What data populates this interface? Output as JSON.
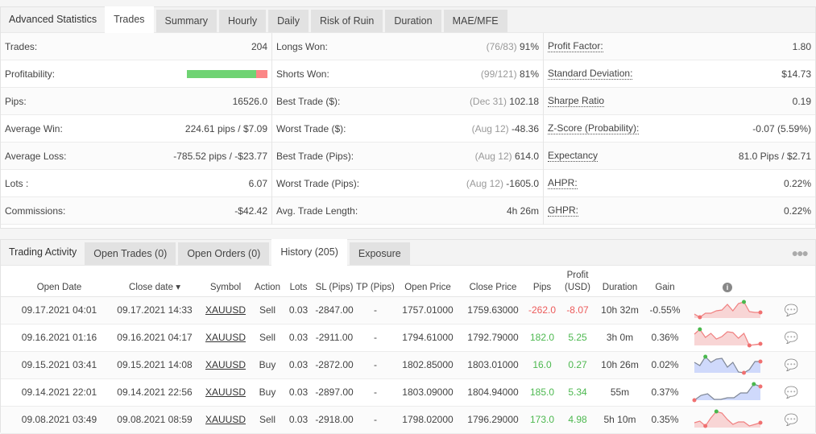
{
  "advanced_stats": {
    "title": "Advanced Statistics",
    "tabs": [
      "Trades",
      "Summary",
      "Hourly",
      "Daily",
      "Risk of Ruin",
      "Duration",
      "MAE/MFE"
    ],
    "active_tab": "Trades",
    "col1": [
      {
        "label": "Trades:",
        "value": "204"
      },
      {
        "label": "Profitability:",
        "value": "",
        "bar_win_fraction": 0.858
      },
      {
        "label": "Pips:",
        "value": "16526.0"
      },
      {
        "label": "Average Win:",
        "value": "224.61 pips / $7.09"
      },
      {
        "label": "Average Loss:",
        "value": "-785.52 pips / -$23.77"
      },
      {
        "label": "Lots :",
        "value": "6.07"
      },
      {
        "label": "Commissions:",
        "value": "-$42.42"
      }
    ],
    "col2": [
      {
        "label": "Longs Won:",
        "muted": "(76/83)",
        "value": "91%"
      },
      {
        "label": "Shorts Won:",
        "muted": "(99/121)",
        "value": "81%"
      },
      {
        "label": "Best Trade ($):",
        "muted": "(Dec 31)",
        "value": "102.18"
      },
      {
        "label": "Worst Trade ($):",
        "muted": "(Aug 12)",
        "value": "-48.36"
      },
      {
        "label": "Best Trade (Pips):",
        "muted": "(Aug 12)",
        "value": "614.0"
      },
      {
        "label": "Worst Trade (Pips):",
        "muted": "(Aug 12)",
        "value": "-1605.0"
      },
      {
        "label": "Avg. Trade Length:",
        "muted": "",
        "value": "4h 26m"
      }
    ],
    "col3": [
      {
        "label": "Profit Factor:",
        "value": "1.80"
      },
      {
        "label": "Standard Deviation:",
        "value": "$14.73"
      },
      {
        "label": "Sharpe Ratio",
        "value": "0.19"
      },
      {
        "label": "Z-Score (Probability):",
        "value": "-0.07 (5.59%)"
      },
      {
        "label": "Expectancy",
        "value": "81.0 Pips / $2.71"
      },
      {
        "label": "AHPR:",
        "value": "0.22%"
      },
      {
        "label": "GHPR:",
        "value": "0.22%"
      }
    ]
  },
  "trading_activity": {
    "title": "Trading Activity",
    "tabs": [
      "Open Trades (0)",
      "Open Orders (0)",
      "History (205)",
      "Exposure"
    ],
    "active_tab": "History (205)",
    "more_icon": "ellipsis-icon",
    "columns": {
      "open_date": "Open Date",
      "close_date": "Close date ▾",
      "symbol": "Symbol",
      "action": "Action",
      "lots": "Lots",
      "sl": "SL (Pips)",
      "tp": "TP (Pips)",
      "open_price": "Open Price",
      "close_price": "Close Price",
      "pips": "Pips",
      "profit": "Profit (USD)",
      "duration": "Duration",
      "gain": "Gain",
      "info": "i"
    },
    "rows": [
      {
        "open_date": "09.17.2021 04:01",
        "close_date": "09.17.2021 14:33",
        "symbol": "XAUUSD",
        "action": "Sell",
        "lots": "0.03",
        "sl": "-2847.00",
        "tp": "-",
        "open_price": "1757.01000",
        "close_price": "1759.63000",
        "pips": "-262.0",
        "profit": "-8.07",
        "duration": "10h 32m",
        "gain": "-0.55%",
        "positive": false,
        "spark": {
          "color": "red",
          "points": [
            0.25,
            0.05,
            0.3,
            0.3,
            0.45,
            0.5,
            0.85,
            0.45,
            0.9,
            1.0,
            0.4,
            0.35,
            0.35
          ],
          "max_index": 9,
          "end_index": 12
        }
      },
      {
        "open_date": "09.16.2021 01:16",
        "close_date": "09.16.2021 04:17",
        "symbol": "XAUUSD",
        "action": "Sell",
        "lots": "0.03",
        "sl": "-2911.00",
        "tp": "-",
        "open_price": "1794.61000",
        "close_price": "1792.79000",
        "pips": "182.0",
        "profit": "5.25",
        "duration": "3h 0m",
        "gain": "0.36%",
        "positive": true,
        "spark": {
          "color": "red",
          "points": [
            0.7,
            1.0,
            0.5,
            0.75,
            0.4,
            0.55,
            0.85,
            0.8,
            0.45,
            0.75,
            0.0,
            0.05,
            0.1
          ],
          "max_index": 1,
          "end_index": 12
        }
      },
      {
        "open_date": "09.15.2021 03:41",
        "close_date": "09.15.2021 14:08",
        "symbol": "XAUUSD",
        "action": "Buy",
        "lots": "0.03",
        "sl": "-2872.00",
        "tp": "-",
        "open_price": "1802.85000",
        "close_price": "1803.01000",
        "pips": "16.0",
        "profit": "0.27",
        "duration": "10h 26m",
        "gain": "0.02%",
        "positive": true,
        "spark": {
          "color": "blue",
          "points": [
            0.65,
            0.45,
            1.0,
            0.65,
            0.85,
            0.9,
            0.35,
            0.65,
            0.05,
            0.0,
            0.2,
            0.7,
            0.7
          ],
          "max_index": 2,
          "end_index": 12
        }
      },
      {
        "open_date": "09.14.2021 22:01",
        "close_date": "09.14.2021 22:56",
        "symbol": "XAUUSD",
        "action": "Buy",
        "lots": "0.03",
        "sl": "-2897.00",
        "tp": "-",
        "open_price": "1803.09000",
        "close_price": "1804.94000",
        "pips": "185.0",
        "profit": "5.34",
        "duration": "55m",
        "gain": "0.37%",
        "positive": true,
        "spark": {
          "color": "blue",
          "points": [
            0.0,
            0.3,
            0.4,
            0.05,
            0.05,
            0.15,
            0.15,
            0.45,
            0.45,
            1.0,
            0.85
          ],
          "max_index": 9,
          "end_index": 10
        }
      },
      {
        "open_date": "09.08.2021 03:49",
        "close_date": "09.08.2021 08:59",
        "symbol": "XAUUSD",
        "action": "Sell",
        "lots": "0.03",
        "sl": "-2918.00",
        "tp": "-",
        "open_price": "1798.02000",
        "close_price": "1796.29000",
        "pips": "173.0",
        "profit": "4.98",
        "duration": "5h 10m",
        "gain": "0.35%",
        "positive": true,
        "spark": {
          "color": "red",
          "points": [
            0.3,
            0.4,
            0.1,
            0.6,
            1.0,
            0.9,
            0.5,
            0.2,
            0.35,
            0.35,
            0.1,
            0.2,
            0.3
          ],
          "max_index": 4,
          "end_index": 12
        }
      }
    ]
  },
  "colors": {
    "positive": "#4cb84f",
    "negative": "#ec5b5b",
    "bar_green": "#6fd373",
    "bar_red": "#fb8686"
  }
}
